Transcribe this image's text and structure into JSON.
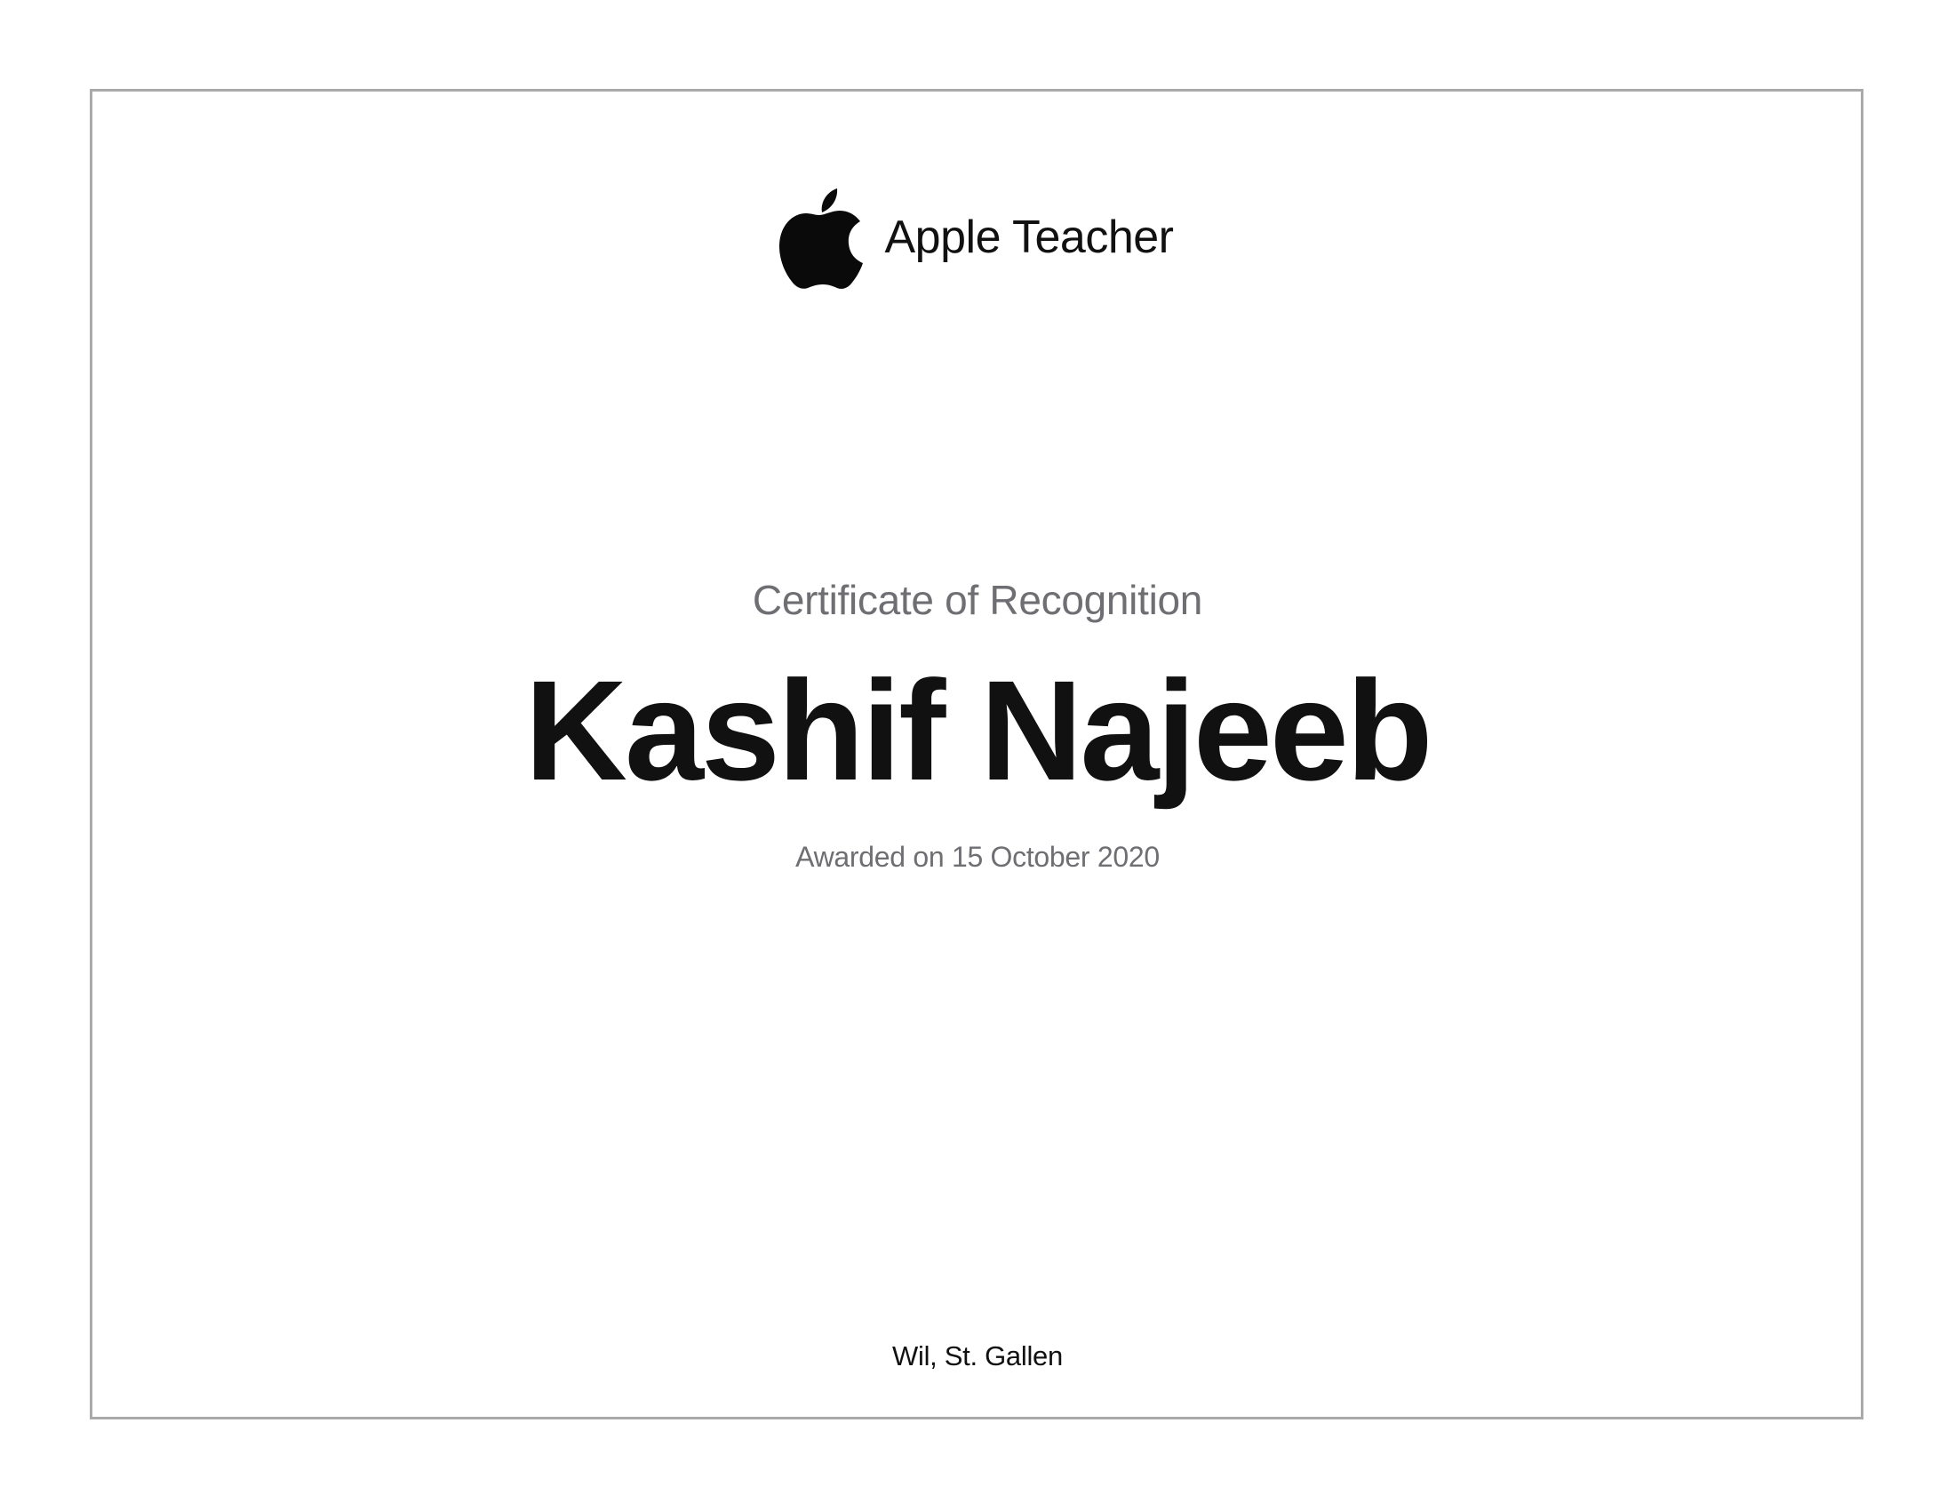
{
  "brand": {
    "logo_icon": "apple-logo-icon",
    "name": "Apple Teacher"
  },
  "certificate": {
    "subtitle": "Certificate of Recognition",
    "recipient": "Kashif Najeeb",
    "awarded": "Awarded on 15 October 2020",
    "location": "Wil, St. Gallen"
  },
  "colors": {
    "primary_text": "#111111",
    "secondary_text": "#6e6e73",
    "border": "#aaaaaa",
    "background": "#ffffff"
  }
}
